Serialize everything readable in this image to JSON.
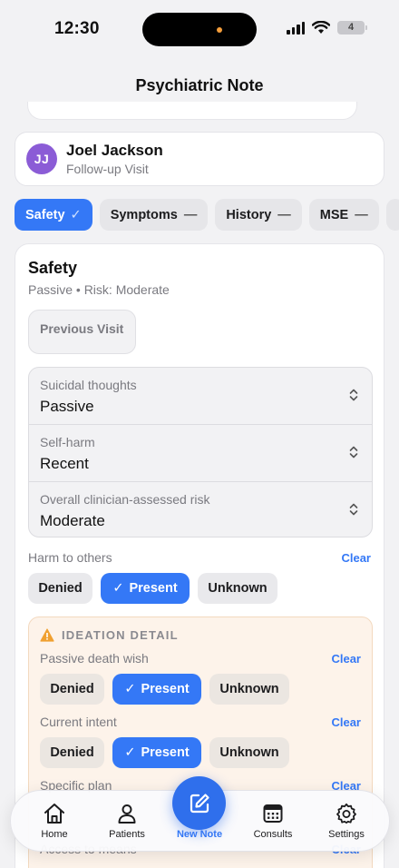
{
  "status_bar": {
    "time": "12:30",
    "battery": "4"
  },
  "nav": {
    "title": "Psychiatric Note"
  },
  "patient": {
    "initials": "JJ",
    "name": "Joel Jackson",
    "visit_type": "Follow-up Visit",
    "avatar_color": "#8b5cd6"
  },
  "tabs": [
    {
      "label": "Safety",
      "state": "complete"
    },
    {
      "label": "Symptoms",
      "state": "incomplete"
    },
    {
      "label": "History",
      "state": "incomplete"
    },
    {
      "label": "MSE",
      "state": "incomplete"
    }
  ],
  "safety": {
    "title": "Safety",
    "summary": "Passive • Risk: Moderate",
    "previous_visit_label": "Previous Visit",
    "selects": [
      {
        "label": "Suicidal thoughts",
        "value": "Passive"
      },
      {
        "label": "Self-harm",
        "value": "Recent"
      },
      {
        "label": "Overall clinician-assessed risk",
        "value": "Moderate"
      }
    ],
    "harm_to_others": {
      "label": "Harm to others",
      "clear": "Clear",
      "options": [
        "Denied",
        "Present",
        "Unknown"
      ],
      "selected": "Present"
    },
    "ideation": {
      "title": "IDEATION DETAIL",
      "fields": [
        {
          "label": "Passive death wish",
          "clear": "Clear",
          "options": [
            "Denied",
            "Present",
            "Unknown"
          ],
          "selected": "Present"
        },
        {
          "label": "Current intent",
          "clear": "Clear",
          "options": [
            "Denied",
            "Present",
            "Unknown"
          ],
          "selected": "Present"
        },
        {
          "label": "Specific plan",
          "clear": "Clear"
        },
        {
          "label": "Access to means",
          "clear": "Clear"
        }
      ]
    }
  },
  "tabbar": {
    "items": [
      {
        "label": "Home",
        "icon": "house-icon"
      },
      {
        "label": "Patients",
        "icon": "person-icon"
      },
      {
        "label": "New Note",
        "icon": "compose-icon"
      },
      {
        "label": "Consults",
        "icon": "calendar-icon"
      },
      {
        "label": "Settings",
        "icon": "gear-icon"
      }
    ]
  },
  "colors": {
    "accent": "#3478f6",
    "ideation_bg": "#fdf3ea",
    "warning": "#f0a030"
  }
}
